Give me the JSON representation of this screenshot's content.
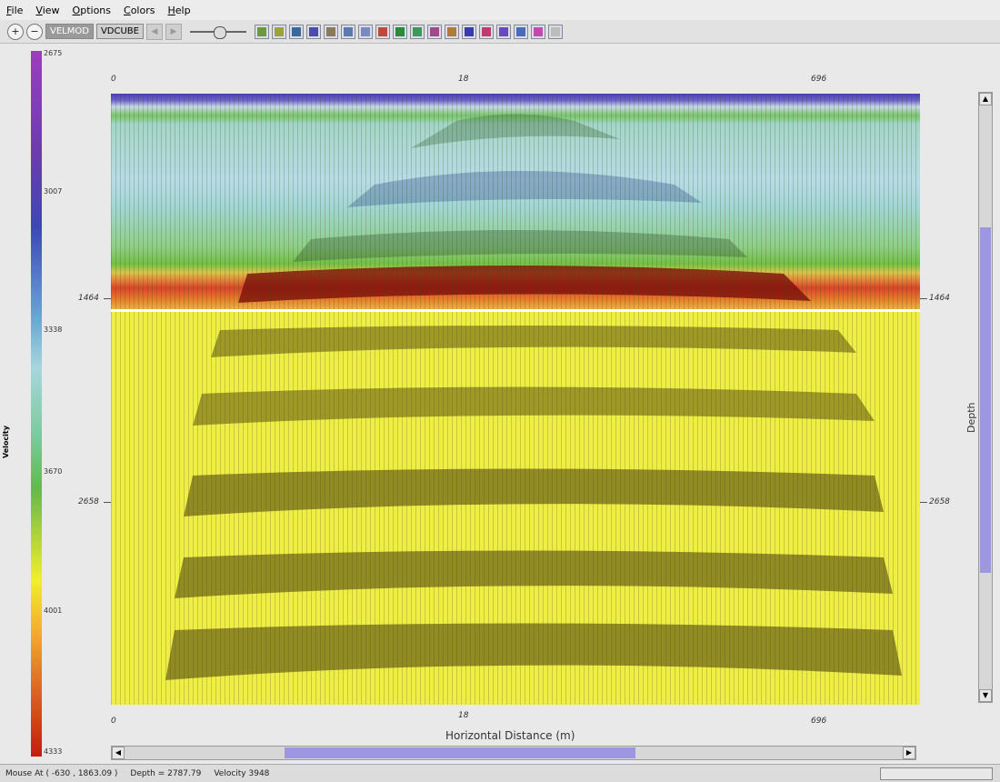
{
  "menu": [
    "File",
    "View",
    "Options",
    "Colors",
    "Help"
  ],
  "toolbar": {
    "zoom_in": "+",
    "zoom_out": "−",
    "tab1": "VELMOD",
    "tab2": "VDCUBE",
    "slider_value": 0.5
  },
  "colorbar": {
    "title": "Velocity",
    "ticks": [
      "2675",
      "3007",
      "3338",
      "3670",
      "4001",
      "4333"
    ]
  },
  "x_axis": {
    "title": "Horizontal Distance (m)",
    "top_ticks": [
      "0",
      "18",
      "696"
    ],
    "bottom_ticks": [
      "0",
      "18",
      "696"
    ]
  },
  "y_axis": {
    "title": "Depth (m)",
    "ticks": [
      "1464",
      "2658"
    ]
  },
  "status": {
    "mouse": "Mouse At  ( -630 , 1863.09 )",
    "depth": "Depth = 2787.79",
    "velocity": "Velocity 3948"
  },
  "colors": {
    "accent": "#9d96e0",
    "scale_top": "#9b3fb8",
    "scale_bottom": "#c51a12"
  }
}
